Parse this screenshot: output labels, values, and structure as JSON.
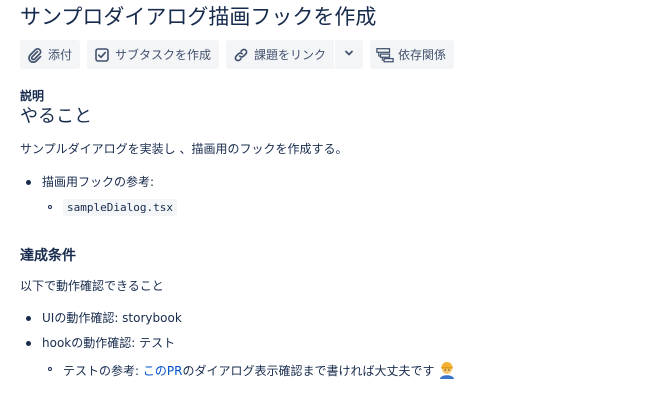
{
  "issue": {
    "title": "サンプロダイアログ描画フックを作成"
  },
  "toolbar": {
    "attach_label": "添付",
    "subtask_label": "サブタスクを作成",
    "link_issue_label": "課題をリンク",
    "dependency_label": "依存関係"
  },
  "description": {
    "label": "説明",
    "heading_todo": "やること",
    "intro": "サンプルダイアログを実装し 、描画用のフックを作成する。",
    "ref_item": "描画用フックの参考:",
    "ref_code": "sampleDialog.tsx",
    "heading_criteria": "達成条件",
    "criteria_intro": "以下で動作確認できること",
    "criteria_item_1": "UIの動作確認: storybook",
    "criteria_item_2": "hookの動作確認: テスト",
    "test_ref_prefix": "テストの参考: ",
    "test_ref_link": "このPR",
    "test_ref_suffix": "のダイアログ表示確認まで書ければ大丈夫です"
  },
  "colors": {
    "text": "#172b4d",
    "link": "#0052cc",
    "button_bg": "#f4f5f7",
    "button_text": "#42526e"
  },
  "icons": [
    "paperclip-icon",
    "checkbox-icon",
    "link-icon",
    "chevron-down-icon",
    "hierarchy-icon",
    "worker-emoji-icon"
  ]
}
